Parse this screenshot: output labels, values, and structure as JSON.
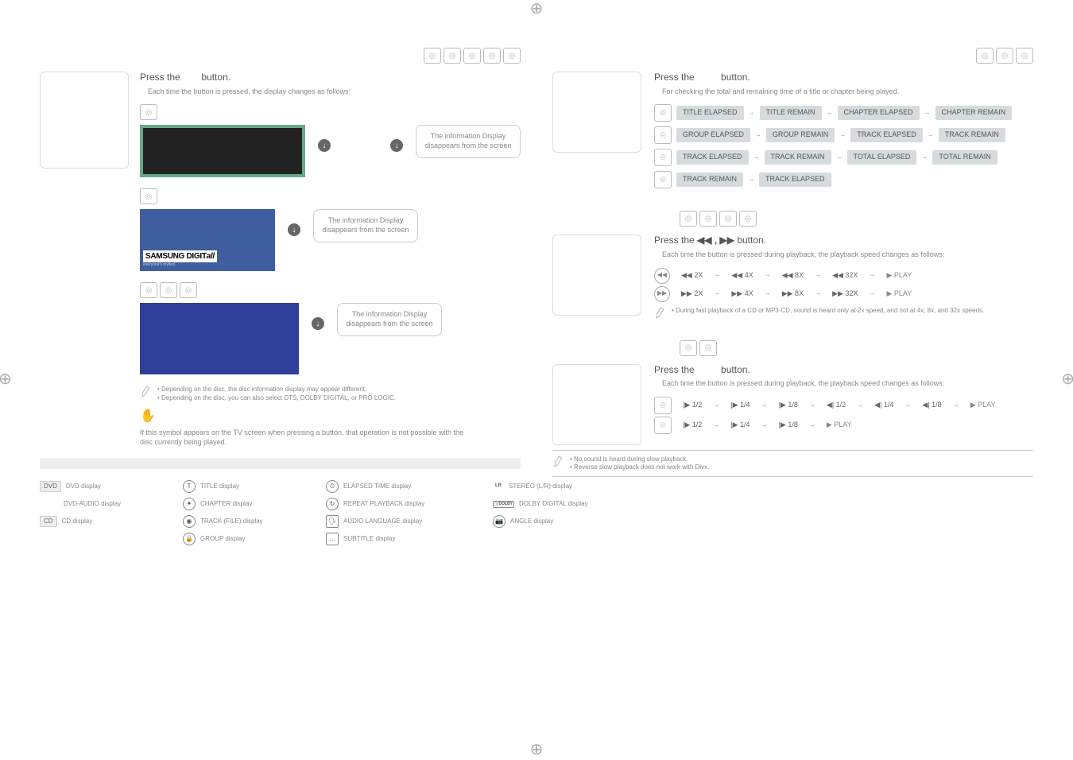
{
  "left": {
    "press_info": "Press the",
    "button_word": "button.",
    "each_time_prefix": "Each time the button is pressed, the display changes as follows:",
    "info_bubble_1": "The information Display disappears from the screen",
    "info_bubble_2": "The information Display disappears from the screen",
    "info_bubble_3": "The information Display disappears from the screen",
    "divx_logo_top": "SAMSUNG DIGIT",
    "divx_logo_italic": "all",
    "divx_tagline": "everyone's invited.",
    "note1_line1": "• Depending on the disc, the disc information display may appear different.",
    "note1_line2": "• Depending on the disc, you can also select DTS, DOLBY DIGITAL, or PRO LOGIC.",
    "hand_text": "If this symbol appears on the TV screen when pressing a button, that operation is not possible with the disc currently being played.",
    "legend": {
      "dvd_tag": "DVD",
      "dvd_label": "DVD display",
      "dvda_label": "DVD-AUDIO display",
      "cd_tag": "CD",
      "cd_label": "CD display",
      "title": "TITLE display",
      "chapter": "CHAPTER display",
      "track": "TRACK (FILE) display",
      "group": "GROUP display",
      "elapsed": "ELAPSED TIME display",
      "repeat": "REPEAT PLAYBACK display",
      "audio_lang": "AUDIO LANGUAGE display",
      "subtitle": "SUBTITLE display",
      "stereo_prefix": "LR",
      "stereo": "STEREO (L/R) display",
      "dolby_tag": "DOLBY",
      "dolby_sub": "DIGITAL",
      "dolby": "DOLBY DIGITAL display",
      "angle": "ANGLE display"
    }
  },
  "right": {
    "remain": {
      "press": "Press the",
      "button": "button.",
      "sub": "For checking the total and remaining time of a title or chapter being played.",
      "rows": [
        [
          "TITLE ELAPSED",
          "TITLE REMAIN",
          "CHAPTER ELAPSED",
          "CHAPTER REMAIN"
        ],
        [
          "GROUP ELAPSED",
          "GROUP REMAIN",
          "TRACK ELAPSED",
          "TRACK REMAIN"
        ],
        [
          "TRACK ELAPSED",
          "TRACK REMAIN",
          "TOTAL ELAPSED",
          "TOTAL REMAIN"
        ],
        [
          "TRACK REMAIN",
          "TRACK ELAPSED"
        ]
      ]
    },
    "fast": {
      "press": "Press the",
      "arrows": "◀◀ , ▶▶",
      "button": "button.",
      "sub": "Each time the button is pressed during playback, the playback speed changes as follows:",
      "rw": [
        "◀◀ 2X",
        "◀◀ 4X",
        "◀◀ 8X",
        "◀◀ 32X"
      ],
      "ff": [
        "▶▶ 2X",
        "▶▶ 4X",
        "▶▶ 8X",
        "▶▶ 32X"
      ],
      "play": "▶ PLAY",
      "note": "• During fast playback of a CD or MP3-CD, sound is heard only at 2x speed, and not at 4x, 8x, and 32x speeds."
    },
    "slow": {
      "press": "Press the",
      "button": "button.",
      "sub": "Each time the button is pressed during playback, the playback speed changes as follows:",
      "row1": [
        "|▶ 1/2",
        "|▶ 1/4",
        "|▶ 1/8",
        "◀| 1/2",
        "◀| 1/4",
        "◀| 1/8"
      ],
      "row2": [
        "|▶ 1/2",
        "|▶ 1/4",
        "|▶ 1/8"
      ],
      "play": "▶ PLAY",
      "note1": "• No sound is heard during slow playback.",
      "note2": "• Reverse slow playback does not work with Divx."
    }
  }
}
